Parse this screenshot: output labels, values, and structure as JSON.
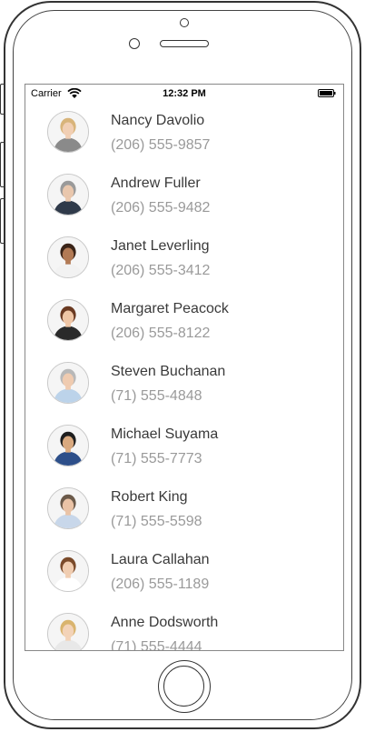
{
  "status_bar": {
    "carrier": "Carrier",
    "time": "12:32 PM",
    "wifi_icon": "wifi-icon",
    "battery_icon": "battery-icon"
  },
  "contacts": [
    {
      "name": "Nancy Davolio",
      "phone": "(206) 555-9857",
      "avatar_colors": {
        "hair": "#d8b47a",
        "skin": "#f1cfb4",
        "shirt": "#8a8a8a"
      }
    },
    {
      "name": "Andrew Fuller",
      "phone": "(206) 555-9482",
      "avatar_colors": {
        "hair": "#9a9a9a",
        "skin": "#e9c7ad",
        "shirt": "#2f3a4a"
      }
    },
    {
      "name": "Janet Leverling",
      "phone": "(206) 555-3412",
      "avatar_colors": {
        "hair": "#3a2418",
        "skin": "#b27a55",
        "shirt": "#f2f2f2"
      }
    },
    {
      "name": "Margaret Peacock",
      "phone": "(206) 555-8122",
      "avatar_colors": {
        "hair": "#6a3a22",
        "skin": "#efc6a6",
        "shirt": "#2a2a2a"
      }
    },
    {
      "name": "Steven Buchanan",
      "phone": "(71) 555-4848",
      "avatar_colors": {
        "hair": "#b8b8b8",
        "skin": "#efcbb0",
        "shirt": "#bcd3ea"
      }
    },
    {
      "name": "Michael Suyama",
      "phone": "(71) 555-7773",
      "avatar_colors": {
        "hair": "#1e1e1e",
        "skin": "#d9a97f",
        "shirt": "#2d4f8a"
      }
    },
    {
      "name": "Robert King",
      "phone": "(71) 555-5598",
      "avatar_colors": {
        "hair": "#6b5a4a",
        "skin": "#eac3a6",
        "shirt": "#c8d7ea"
      }
    },
    {
      "name": "Laura Callahan",
      "phone": "(206) 555-1189",
      "avatar_colors": {
        "hair": "#7a4a2a",
        "skin": "#f0cdb1",
        "shirt": "#ffffff"
      }
    },
    {
      "name": "Anne Dodsworth",
      "phone": "(71) 555-4444",
      "avatar_colors": {
        "hair": "#d9b46e",
        "skin": "#f3d3b8",
        "shirt": "#e8e8e8"
      }
    }
  ]
}
